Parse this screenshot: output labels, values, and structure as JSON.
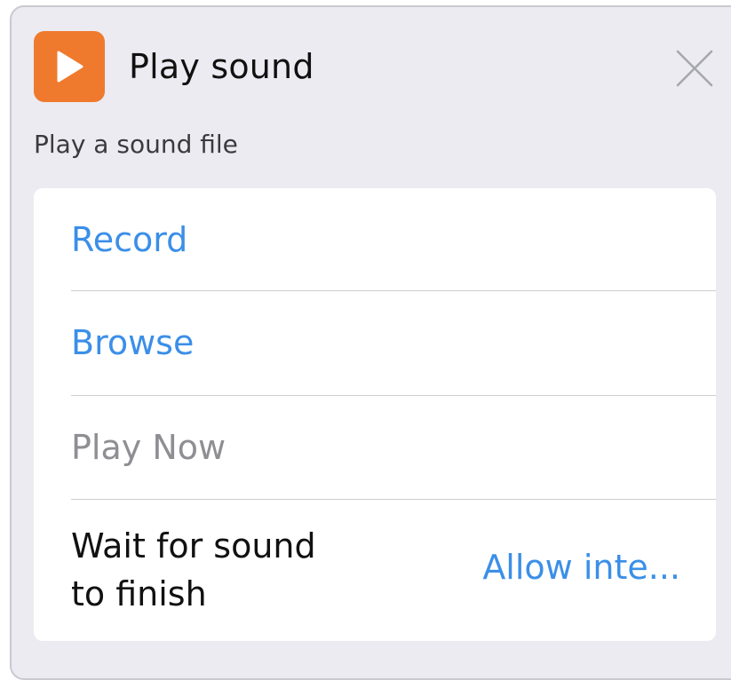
{
  "header": {
    "icon": "play-icon",
    "title": "Play sound",
    "close_icon": "close-icon"
  },
  "subtitle": "Play a sound file",
  "colors": {
    "accent": "#ef7a2e",
    "link": "#3b8fe8",
    "disabled": "#8e8e93"
  },
  "options": {
    "record": "Record",
    "browse": "Browse",
    "play_now": "Play Now",
    "wait_label_line1": "Wait for sound",
    "wait_label_line2": "to finish",
    "wait_value": "Allow inte..."
  }
}
